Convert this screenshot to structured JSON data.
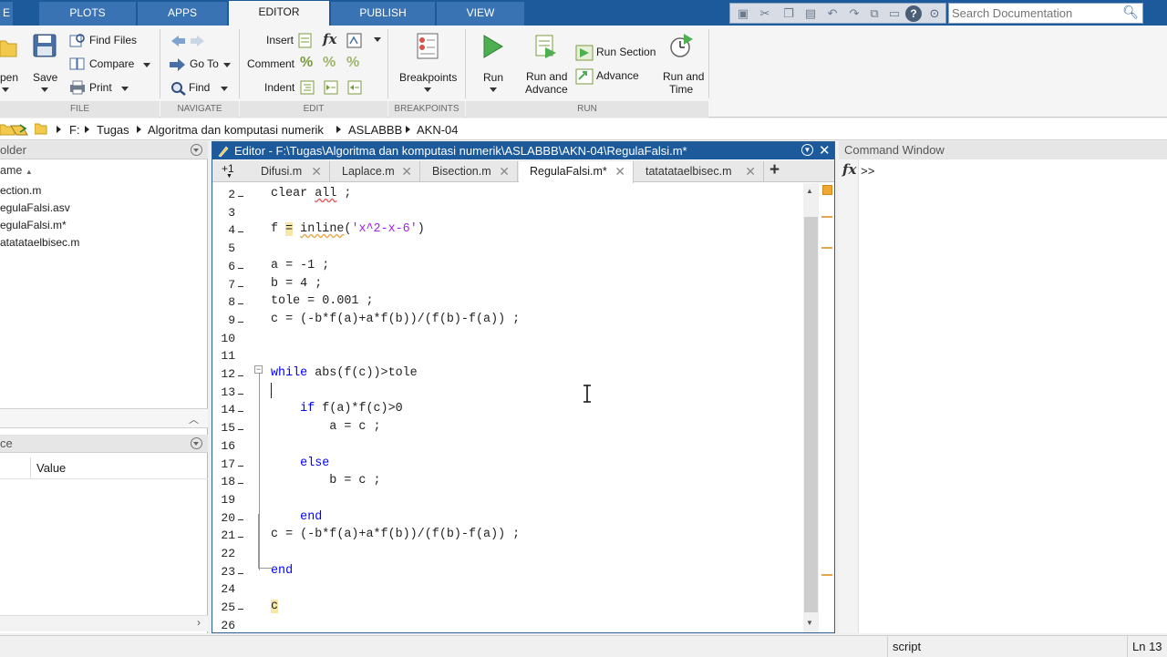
{
  "ribbon": {
    "tabs": [
      {
        "label": "E"
      },
      {
        "label": "PLOTS"
      },
      {
        "label": "APPS"
      },
      {
        "label": "EDITOR"
      },
      {
        "label": "PUBLISH"
      },
      {
        "label": "VIEW"
      }
    ],
    "search_placeholder": "Search Documentation",
    "file": {
      "open": "pen",
      "save": "Save",
      "find_files": "Find Files",
      "compare": "Compare",
      "print": "Print",
      "section": "FILE"
    },
    "navigate": {
      "go_to": "Go To",
      "find": "Find",
      "section": "NAVIGATE"
    },
    "edit": {
      "insert": "Insert",
      "comment": "Comment",
      "indent": "Indent",
      "section": "EDIT",
      "fx": "fx"
    },
    "breakpoints": {
      "label": "Breakpoints",
      "section": "BREAKPOINTS"
    },
    "run": {
      "run": "Run",
      "run_and_advance_1": "Run and",
      "run_and_advance_2": "Advance",
      "run_section": "Run Section",
      "advance": "Advance",
      "run_and_time_1": "Run and",
      "run_and_time_2": "Time",
      "section": "RUN"
    }
  },
  "address": {
    "crumbs": [
      "F:",
      "Tugas",
      "Algoritma dan komputasi numerik",
      "ASLABBB",
      "AKN-04"
    ]
  },
  "left_panel": {
    "folder_header": "older",
    "column_name": "ame",
    "files": [
      "ection.m",
      "egulaFalsi.asv",
      "egulaFalsi.m*",
      "atatataelbisec.m"
    ],
    "workspace_header": "ce",
    "value_header": "Value"
  },
  "editor": {
    "title": "Editor - F:\\Tugas\\Algoritma dan komputasi numerik\\ASLABBB\\AKN-04\\RegulaFalsi.m*",
    "tab_scroll": "+1",
    "tabs": [
      {
        "label": "Difusi.m",
        "active": false
      },
      {
        "label": "Laplace.m",
        "active": false
      },
      {
        "label": "Bisection.m",
        "active": false
      },
      {
        "label": "RegulaFalsi.m*",
        "active": true
      },
      {
        "label": "tatatataelbisec.m",
        "active": false
      }
    ],
    "line_numbers": [
      "2",
      "3",
      "4",
      "5",
      "6",
      "7",
      "8",
      "9",
      "10",
      "11",
      "12",
      "13",
      "14",
      "15",
      "16",
      "17",
      "18",
      "19",
      "20",
      "21",
      "22",
      "23",
      "24",
      "25",
      "26"
    ]
  },
  "command_window": {
    "title": "Command Window",
    "prompt": ">>",
    "fx": "fx"
  },
  "status": {
    "mode": "script",
    "position": "Ln 13"
  },
  "colors": {
    "ribbon_blue": "#1c5a9c",
    "keyword": "#0000ff",
    "string": "#a020f0"
  }
}
